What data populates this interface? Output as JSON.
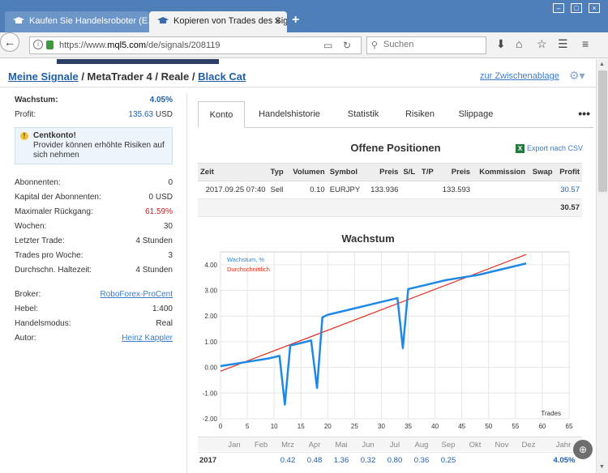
{
  "browser": {
    "tabs": [
      {
        "title": "Kaufen Sie Handelsroboter (E…",
        "active": false
      },
      {
        "title": "Kopieren von Trades des Sign…",
        "active": true
      }
    ],
    "url_prefix": "https://www.",
    "url_domain": "mql5.com",
    "url_path": "/de/signals/208119",
    "search_placeholder": "Suchen"
  },
  "breadcrumb": {
    "link1": "Meine Signale",
    "sep1": " / MetaTrader 4 / Reale / ",
    "link2": "Black Cat"
  },
  "clipboard_link": "zur Zwischenablage",
  "summary": {
    "growth_label": "Wachstum:",
    "growth_value": "4.05%",
    "profit_label": "Profit:",
    "profit_value": "135.63",
    "profit_currency": "USD",
    "warning_title": "Centkonto!",
    "warning_text": "Provider können erhöhte Risiken auf sich nehmen",
    "stats": [
      {
        "label": "Abonnenten:",
        "value": "0"
      },
      {
        "label": "Kapital der Abonnenten:",
        "value": "0 USD"
      },
      {
        "label": "Maximaler Rückgang:",
        "value": "61.59%"
      },
      {
        "label": "Wochen:",
        "value": "30"
      },
      {
        "label": "Letzter Trade:",
        "value": "4 Stunden"
      },
      {
        "label": "Trades pro Woche:",
        "value": "3"
      },
      {
        "label": "Durchschn. Haltezeit:",
        "value": "4 Stunden"
      }
    ],
    "broker_label": "Broker:",
    "broker_value": "RoboForex-ProCent",
    "leverage_label": "Hebel:",
    "leverage_value": "1:400",
    "mode_label": "Handelsmodus:",
    "mode_value": "Real",
    "author_label": "Autor:",
    "author_value": "Heinz Kappler"
  },
  "tabs": [
    "Konto",
    "Handelshistorie",
    "Statistik",
    "Risiken",
    "Slippage"
  ],
  "more_label": "•••",
  "positions": {
    "title": "Offene Positionen",
    "export_label": "Export nach CSV",
    "headers": [
      "Zeit",
      "Typ",
      "Volumen",
      "Symbol",
      "Preis",
      "S/L",
      "T/P",
      "Preis",
      "Kommission",
      "Swap",
      "Profit"
    ],
    "row": [
      "2017.09.25 07:40",
      "Sell",
      "0.10",
      "EURJPY",
      "133.936",
      "",
      "",
      "133.593",
      "",
      "",
      "30.57"
    ],
    "total": "30.57"
  },
  "growth_title": "Wachstum",
  "chart_data": {
    "type": "line",
    "xlabel": "Trades",
    "xlim": [
      0,
      65
    ],
    "ylim": [
      -2,
      4.5
    ],
    "xticks": [
      0,
      5,
      10,
      15,
      20,
      25,
      30,
      35,
      40,
      45,
      50,
      55,
      60,
      65
    ],
    "yticks": [
      -2.0,
      -1.0,
      0.0,
      1.0,
      2.0,
      3.0,
      4.0
    ],
    "legend": [
      "Wachstum, %",
      "Durchschnittlich"
    ],
    "colors": {
      "growth": "#1e88e5",
      "average": "#e0301e"
    },
    "series": [
      {
        "name": "Wachstum, %",
        "x": [
          0,
          3,
          6,
          9,
          11,
          12,
          13,
          15,
          16.9,
          18,
          19,
          20,
          22,
          25,
          28,
          31,
          33,
          34,
          35,
          37,
          40,
          42,
          45,
          48,
          51,
          54,
          57
        ],
        "y": [
          0.05,
          0.15,
          0.25,
          0.35,
          0.45,
          -1.45,
          0.85,
          0.95,
          1.05,
          -0.8,
          1.95,
          2.05,
          2.15,
          2.3,
          2.45,
          2.6,
          2.7,
          0.75,
          3.05,
          3.15,
          3.3,
          3.4,
          3.5,
          3.6,
          3.75,
          3.9,
          4.05
        ]
      },
      {
        "name": "Durchschnittlich",
        "x": [
          0,
          57
        ],
        "y": [
          -0.15,
          4.4
        ]
      }
    ]
  },
  "monthly": {
    "months": [
      "Jan",
      "Feb",
      "Mrz",
      "Apr",
      "Mai",
      "Jun",
      "Jul",
      "Aug",
      "Sep",
      "Okt",
      "Nov",
      "Dez"
    ],
    "year_label": "Jahr",
    "year": "2017",
    "values": [
      "",
      "",
      "0.42",
      "0.48",
      "1.36",
      "0.32",
      "0.80",
      "0.36",
      "0.25",
      "",
      "",
      ""
    ],
    "year_total": "4.05%"
  }
}
